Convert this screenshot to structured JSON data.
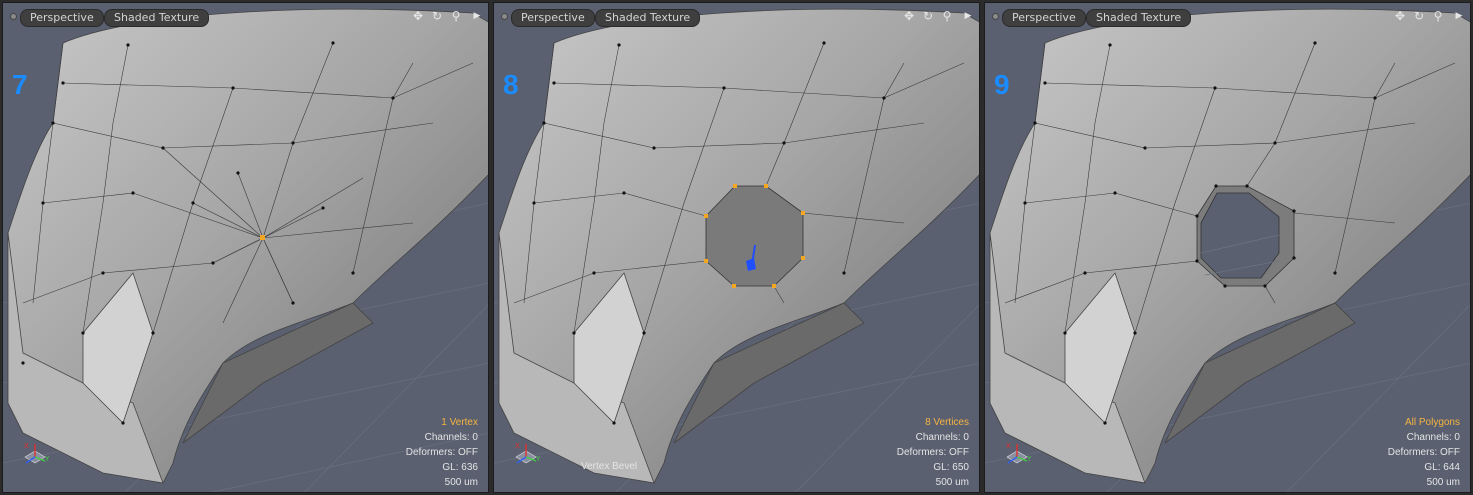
{
  "viewports": [
    {
      "step_number": "7",
      "view_label": "Perspective",
      "shading_label": "Shaded Texture",
      "selection_info": "1 Vertex",
      "channels": "Channels: 0",
      "deformers": "Deformers: OFF",
      "gl": "GL: 636",
      "grid_size": "500 um",
      "tool_label": "",
      "axis_labels": {
        "x": "X",
        "y": "Y"
      }
    },
    {
      "step_number": "8",
      "view_label": "Perspective",
      "shading_label": "Shaded Texture",
      "selection_info": "8 Vertices",
      "channels": "Channels: 0",
      "deformers": "Deformers: OFF",
      "gl": "GL: 650",
      "grid_size": "500 um",
      "tool_label": "Vertex Bevel",
      "axis_labels": {
        "x": "X",
        "y": "Y"
      }
    },
    {
      "step_number": "9",
      "view_label": "Perspective",
      "shading_label": "Shaded Texture",
      "selection_info": "All Polygons",
      "channels": "Channels: 0",
      "deformers": "Deformers: OFF",
      "gl": "GL: 644",
      "grid_size": "500 um",
      "tool_label": "",
      "axis_labels": {
        "x": "X",
        "y": "Y"
      }
    }
  ],
  "toolbar_icons": [
    "move-view-icon",
    "rotate-view-icon",
    "zoom-view-icon",
    "expand-arrow-icon"
  ],
  "colors": {
    "step_number": "#1a8cff",
    "selection_highlight": "#f5b342",
    "background_grid": "#5a6070",
    "mesh": "#9a9a9a"
  }
}
